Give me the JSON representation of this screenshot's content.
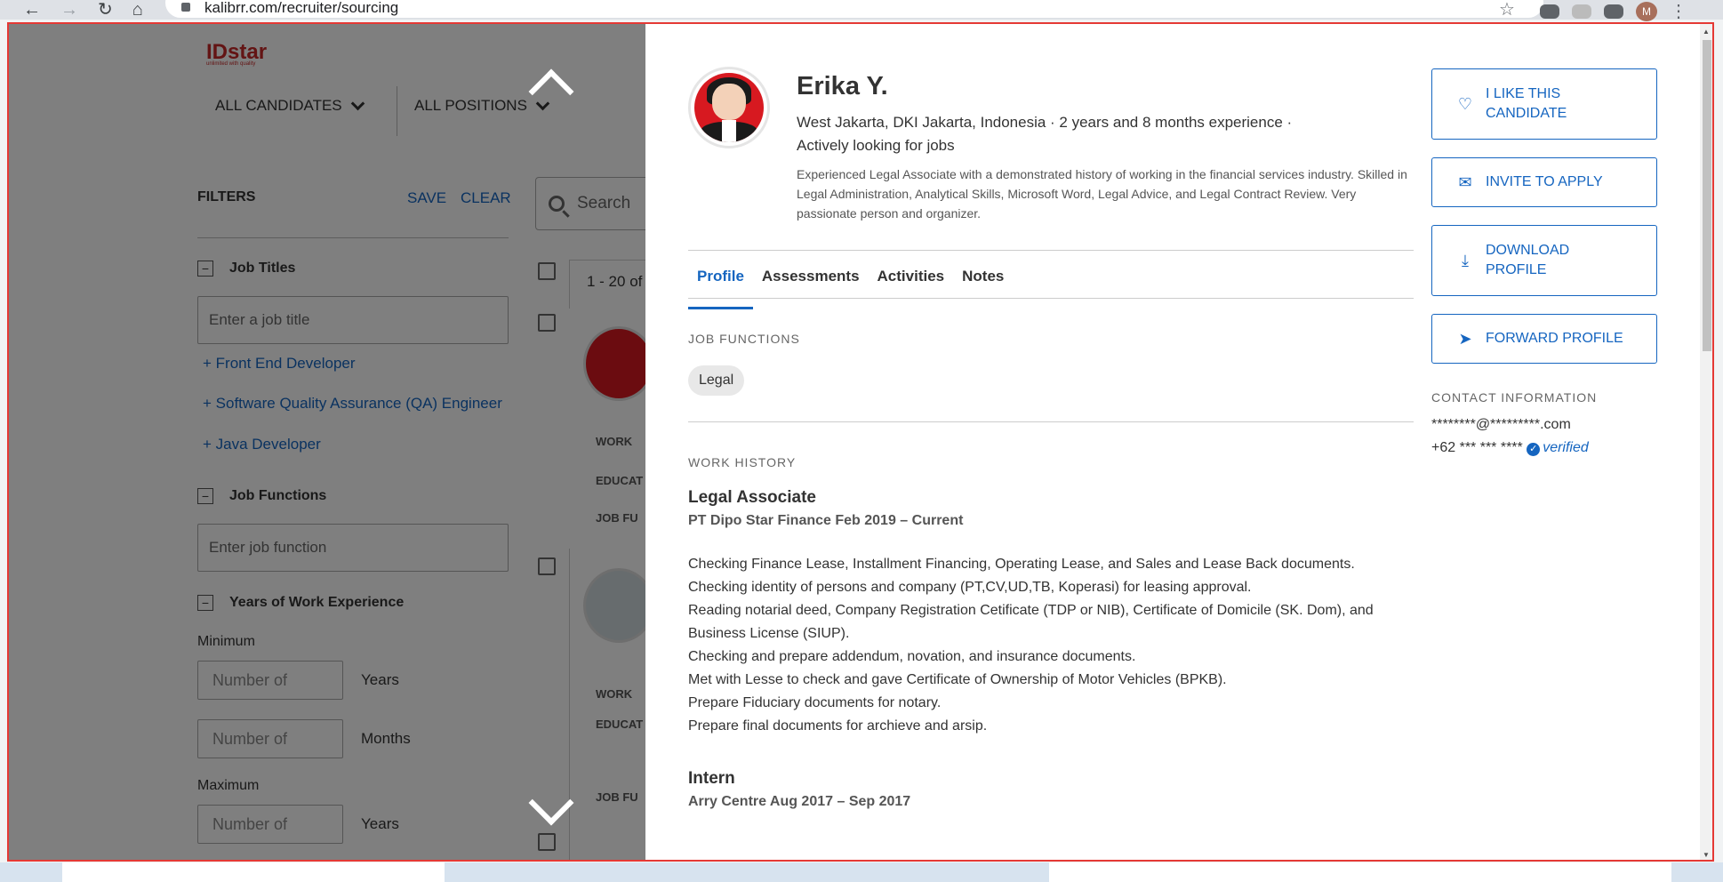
{
  "browser": {
    "url": "kalibrr.com/recruiter/sourcing",
    "avatar_initial": "M"
  },
  "app": {
    "logo_main": "IDstar",
    "logo_tagline": "unlimited with quality",
    "dropdowns": [
      "ALL CANDIDATES",
      "ALL POSITIONS"
    ]
  },
  "filters": {
    "title": "FILTERS",
    "save": "SAVE",
    "clear": "CLEAR",
    "job_titles": {
      "label": "Job Titles",
      "placeholder": "Enter a job title",
      "suggestions": [
        "+ Front End Developer",
        "+ Software Quality Assurance (QA) Engineer",
        "+ Java Developer"
      ]
    },
    "job_functions": {
      "label": "Job Functions",
      "placeholder": "Enter job function"
    },
    "experience": {
      "label": "Years of Work Experience",
      "minimum": "Minimum",
      "maximum": "Maximum",
      "number_placeholder": "Number of",
      "years": "Years",
      "months": "Months"
    }
  },
  "list": {
    "search_placeholder": "Search",
    "count": "1 - 20 of",
    "card_labels": [
      "WORK",
      "EDUCAT",
      "JOB FU"
    ],
    "card2_labels": [
      "WORK",
      "EDUCAT",
      "JOB FU"
    ]
  },
  "profile": {
    "name": "Erika Y.",
    "location": "West Jakarta, DKI Jakarta, Indonesia · 2 years and 8 months experience · Actively looking for jobs",
    "summary": "Experienced Legal Associate with a demonstrated history of working in the financial services industry. Skilled in Legal Administration, Analytical Skills, Microsoft Word, Legal Advice, and Legal Contract Review. Very passionate person and organizer.",
    "tabs": [
      "Profile",
      "Assessments",
      "Activities",
      "Notes"
    ],
    "job_functions_heading": "JOB FUNCTIONS",
    "job_function": "Legal",
    "work_history_heading": "WORK HISTORY",
    "jobs": [
      {
        "title": "Legal Associate",
        "meta": "PT Dipo Star Finance  Feb 2019 – Current",
        "lines": [
          "Checking Finance Lease, Installment Financing, Operating Lease, and Sales and Lease Back documents.",
          "Checking identity of persons and company (PT,CV,UD,TB, Koperasi) for leasing approval.",
          "Reading notarial deed, Company Registration Cetificate (TDP or NIB), Certificate of Domicile (SK. Dom), and Business License (SIUP).",
          "Checking and prepare addendum, novation, and insurance documents.",
          "Met with Lesse to check and gave Certificate of Ownership of Motor Vehicles (BPKB).",
          "Prepare Fiduciary documents for notary.",
          "Prepare final documents for archieve and arsip."
        ]
      },
      {
        "title": "Intern",
        "meta": "Arry Centre  Aug 2017 – Sep 2017"
      }
    ]
  },
  "actions": {
    "like": "I LIKE THIS CANDIDATE",
    "invite": "INVITE TO APPLY",
    "download": "DOWNLOAD PROFILE",
    "forward": "FORWARD PROFILE"
  },
  "contact": {
    "heading": "CONTACT INFORMATION",
    "email": "********@*********.com",
    "phone": "+62 *** *** ****",
    "verified": "verified"
  },
  "colors": {
    "accent": "#1565c0",
    "frame_border": "#e53935"
  }
}
